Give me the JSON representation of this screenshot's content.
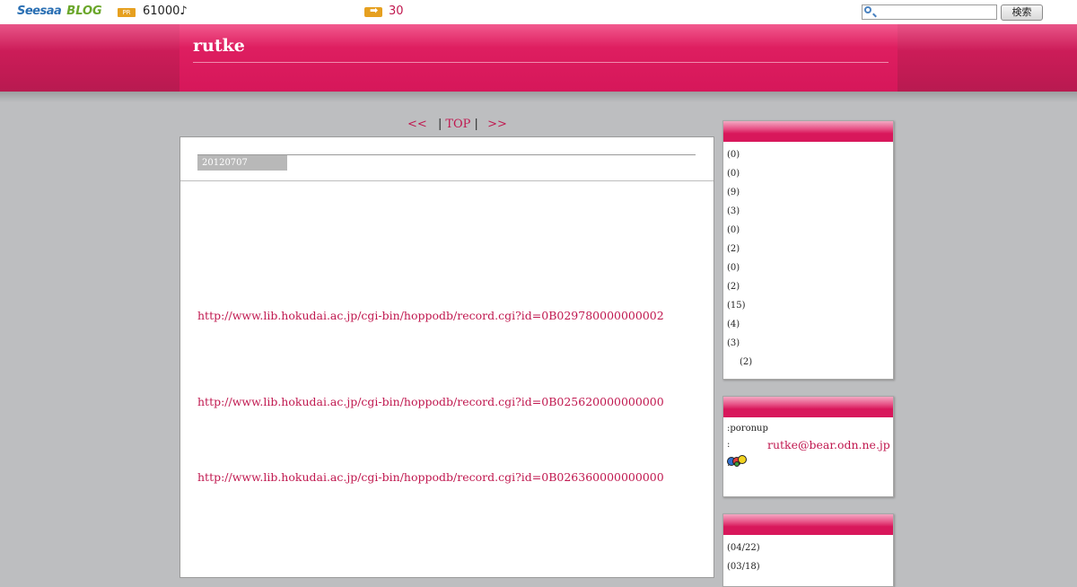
{
  "topbar": {
    "logo_seesaa": "Seesaa",
    "logo_blog": "BLOG",
    "pr_badge": "PR",
    "pr_text": "61000♪",
    "count_text": "30",
    "search_placeholder": "",
    "search_button": "検索"
  },
  "header": {
    "title": "rutke"
  },
  "pager": {
    "prev": "<<",
    "sep1": "|",
    "top": "TOP",
    "sep2": "|",
    "next": ">>"
  },
  "post": {
    "date": "20120707",
    "links": [
      "http://www.lib.hokudai.ac.jp/cgi-bin/hoppodb/record.cgi?id=0B029780000000002",
      "http://www.lib.hokudai.ac.jp/cgi-bin/hoppodb/record.cgi?id=0B025620000000000",
      "http://www.lib.hokudai.ac.jp/cgi-bin/hoppodb/record.cgi?id=0B026360000000000"
    ]
  },
  "sidebar": {
    "categories": [
      "(0)",
      "(0)",
      "(9)",
      "(3)",
      "(0)",
      "(2)",
      "(0)",
      "(2)",
      "(15)",
      "(4)",
      "(3)",
      "(2)"
    ],
    "profile": {
      "line1": ":poronup",
      "line2_prefix": ":",
      "email": "rutke@bear.odn.ne.jp",
      "line3": ":"
    },
    "recent": [
      "(04/22)",
      "(03/18)"
    ]
  },
  "colors": {
    "accent": "#d8175b",
    "link": "#c0184f",
    "background": "#bdbec0"
  }
}
